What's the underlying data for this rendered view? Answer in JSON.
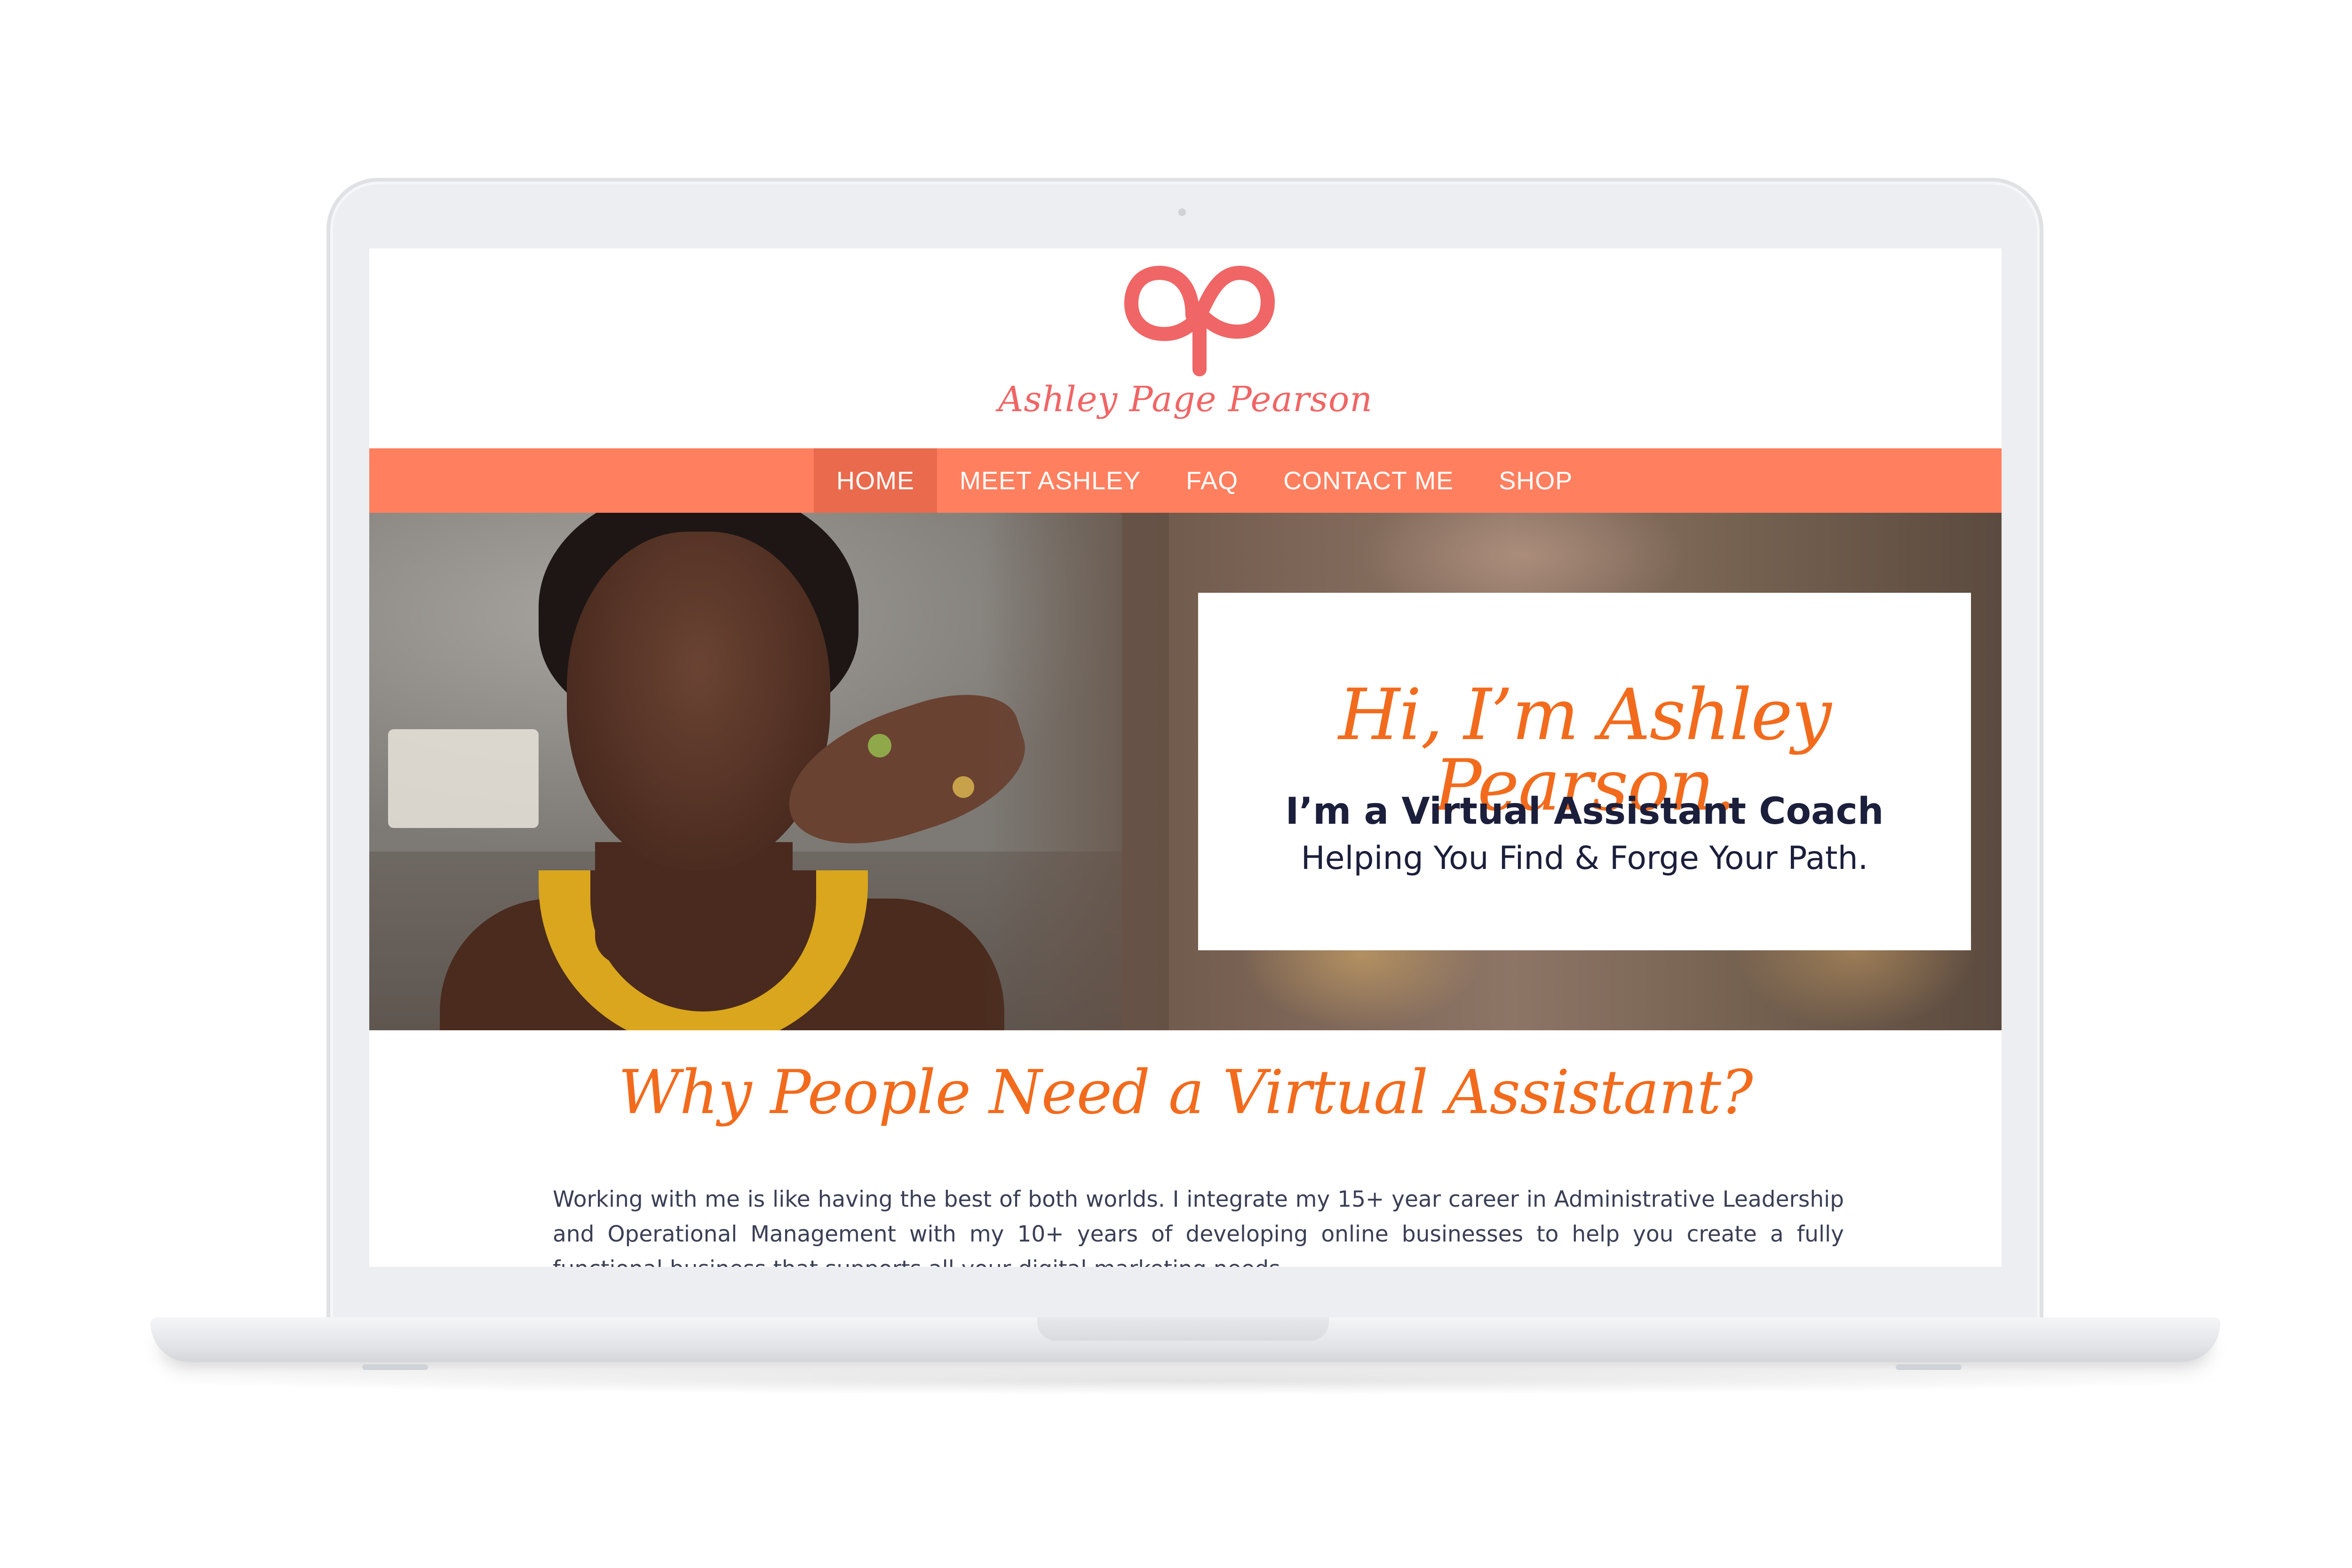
{
  "brand": {
    "name": "Ashley Page Pearson",
    "logo_color": "#f06565"
  },
  "nav": {
    "items": [
      {
        "label": "HOME",
        "active": true
      },
      {
        "label": "MEET ASHLEY",
        "active": false
      },
      {
        "label": "FAQ",
        "active": false
      },
      {
        "label": "CONTACT ME",
        "active": false
      },
      {
        "label": "SHOP",
        "active": false
      }
    ],
    "bar_color": "#ff7f5f",
    "active_color": "#e96a4d"
  },
  "hero": {
    "greeting": "Hi, I’m Ashley Pearson.",
    "role": "I’m a Virtual Assistant Coach",
    "tagline": "Helping You Find & Forge Your Path."
  },
  "why": {
    "heading": "Why People Need a Virtual Assistant?",
    "body": "Working with me is like having the best of both worlds. I integrate my 15+ year career in Administrative Leadership and Operational Management with my 10+ years of developing online businesses to help you create a fully functional business that supports all your digital marketing needs."
  },
  "colors": {
    "accent": "#f26b1d",
    "text_dark": "#1b1f3b"
  }
}
